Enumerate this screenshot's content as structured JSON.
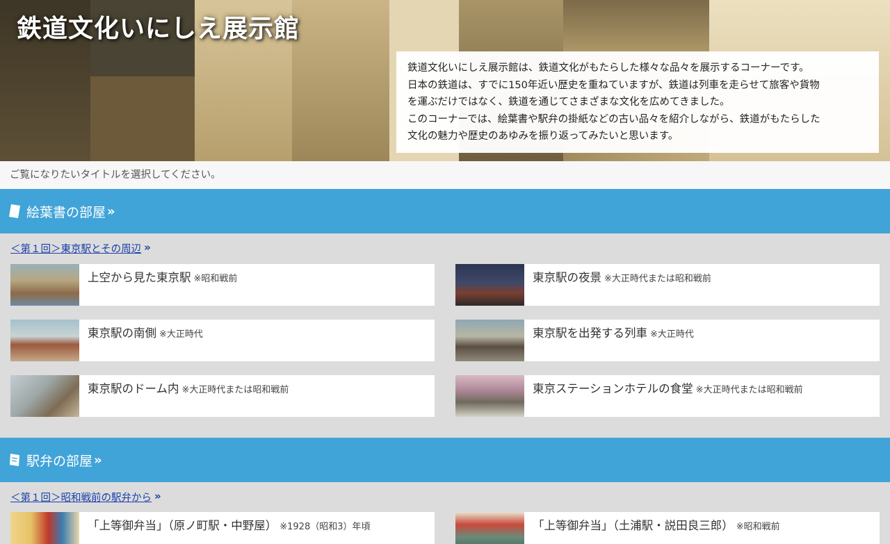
{
  "hero": {
    "title": "鉄道文化いにしえ展示館",
    "description": [
      "鉄道文化いにしえ展示館は、鉄道文化がもたらした様々な品々を展示するコーナーです。",
      "日本の鉄道は、すでに150年近い歴史を重ねていますが、鉄道は列車を走らせて旅客や貨物",
      "を運ぶだけではなく、鉄道を通じてさまざまな文化を広めてきました。",
      "このコーナーでは、絵葉書や駅弁の掛紙などの古い品々を紹介しながら、鉄道がもたらした",
      "文化の魅力や歴史のあゆみを振り返ってみたいと思います。"
    ]
  },
  "instruction": "ご覧になりたいタイトルを選択してください。",
  "sections": [
    {
      "title": "絵葉書の部屋",
      "chevron": "»",
      "icon": "postcard-icon",
      "series_link": "＜第１回＞東京駅とその周辺",
      "series_chevron": "»",
      "items": [
        {
          "title": "上空から見た東京駅",
          "note": "※昭和戦前"
        },
        {
          "title": "東京駅の夜景",
          "note": "※大正時代または昭和戦前"
        },
        {
          "title": "東京駅の南側",
          "note": "※大正時代"
        },
        {
          "title": "東京駅を出発する列車",
          "note": "※大正時代"
        },
        {
          "title": "東京駅のドーム内",
          "note": "※大正時代または昭和戦前"
        },
        {
          "title": "東京ステーションホテルの食堂",
          "note": "※大正時代または昭和戦前"
        }
      ]
    },
    {
      "title": "駅弁の部屋",
      "chevron": "»",
      "icon": "bento-wrapper-icon",
      "series_link": "＜第１回＞昭和戦前の駅弁から",
      "series_chevron": "»",
      "items": [
        {
          "title": "「上等御弁当」（原ノ町駅・中野屋）",
          "note": "※1928（昭和3）年頃"
        },
        {
          "title": "「上等御弁当」（土浦駅・説田良三郎）",
          "note": "※昭和戦前"
        }
      ]
    }
  ],
  "colors": {
    "section_header": "#41a4d8",
    "link": "#1a3fa8",
    "page_bg": "#dcdcdc"
  }
}
